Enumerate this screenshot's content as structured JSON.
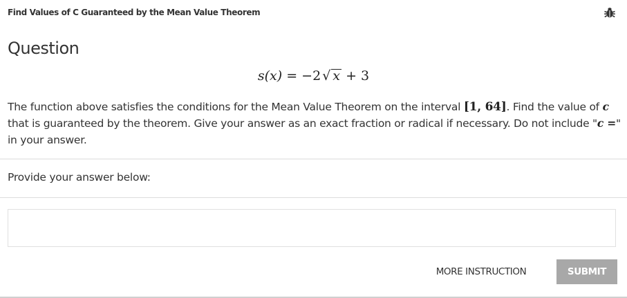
{
  "header": {
    "title": "Find Values of C Guaranteed by the Mean Value Theorem",
    "bug_icon": "bug-icon"
  },
  "question": {
    "heading": "Question",
    "formula": {
      "lhs": "s(x)",
      "equals": "=",
      "coef": "−2",
      "radical": "√",
      "radicand": "x",
      "plus": "+",
      "constant": "3"
    },
    "text_1": "The function above satisfies the conditions for the Mean Value Theorem on the interval ",
    "interval": "[1, 64]",
    "text_2": ". Find the value of ",
    "var_c": "c",
    "text_3": " that is guaranteed by the theorem. Give your answer as an exact fraction or radical if necessary. Do not include \"",
    "c_equals": "c =",
    "text_4": "\" in your answer."
  },
  "answer": {
    "prompt": "Provide your answer below:",
    "value": "",
    "placeholder": ""
  },
  "buttons": {
    "more_instruction": "MORE INSTRUCTION",
    "submit": "SUBMIT"
  },
  "colors": {
    "submit_bg": "#a8a8a8",
    "text": "#333333",
    "divider": "#dcdcdc"
  }
}
